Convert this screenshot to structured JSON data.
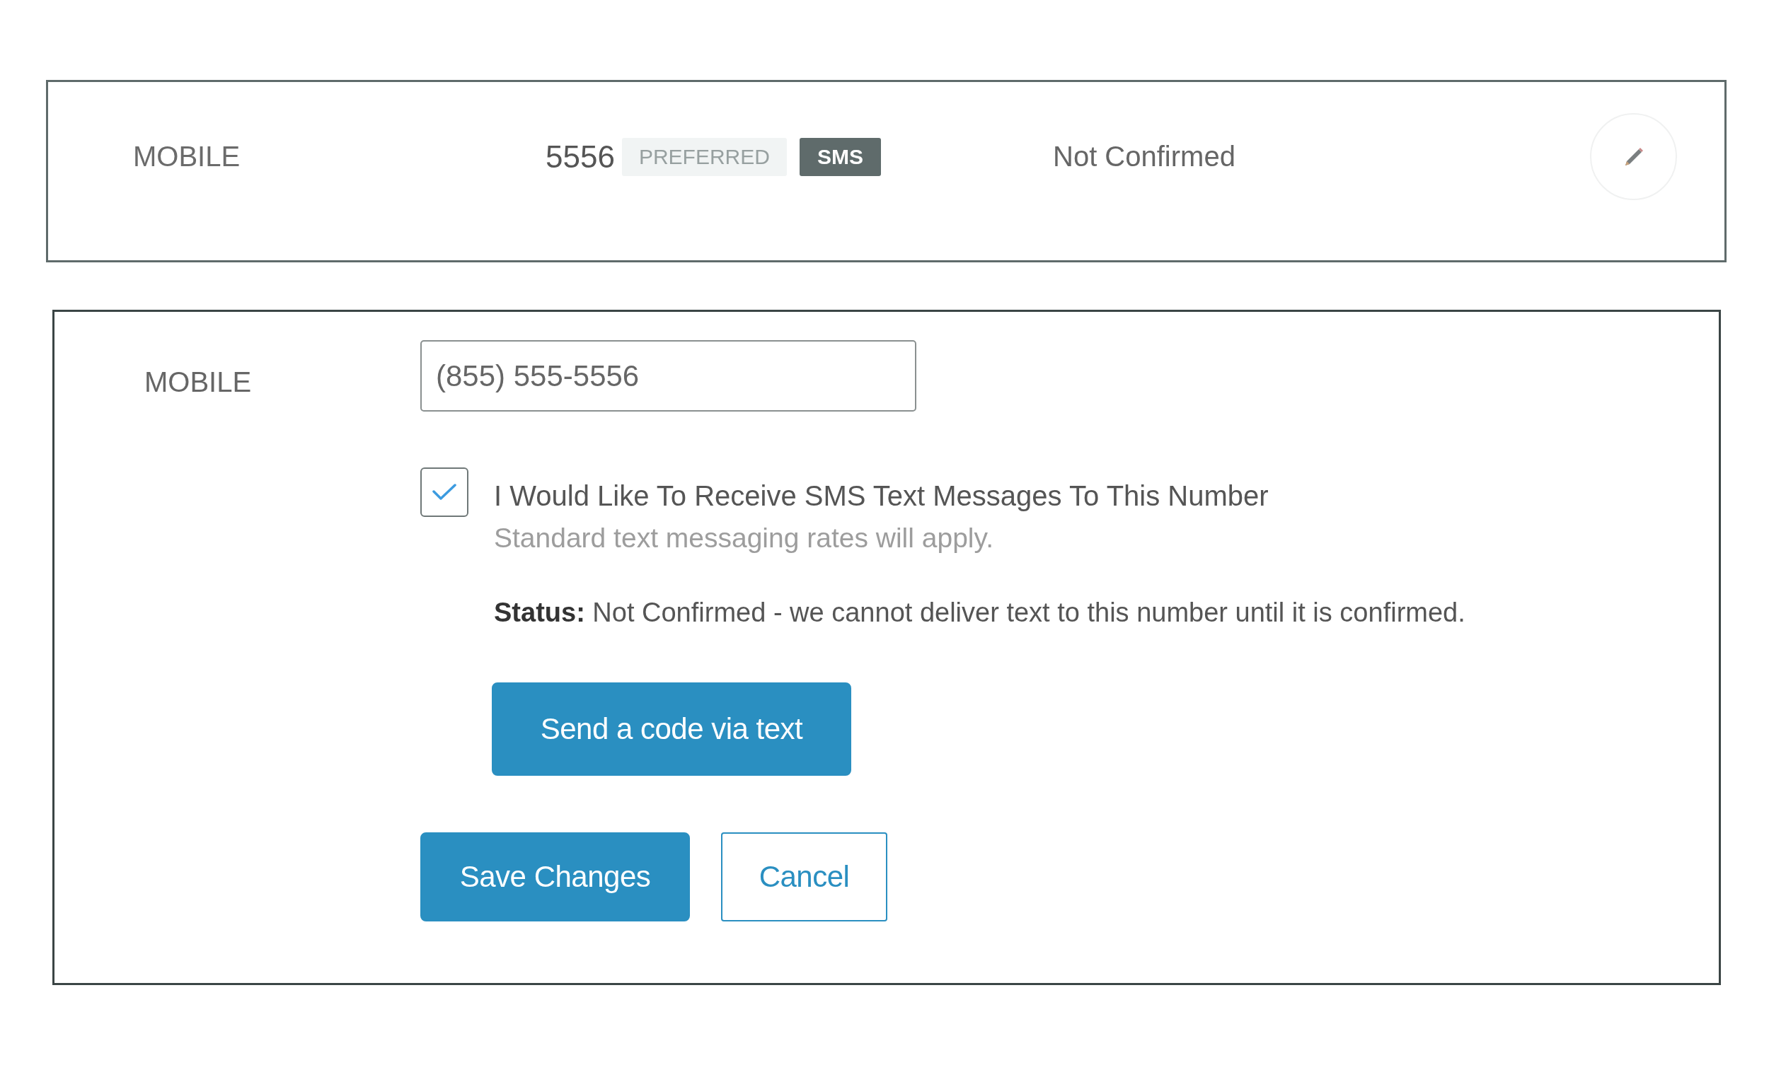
{
  "summary_card": {
    "type_label": "MOBILE",
    "number": "5556",
    "badges": [
      {
        "label": "PREFERRED",
        "kind": "light"
      },
      {
        "label": "SMS",
        "kind": "dark"
      }
    ],
    "status": "Not Confirmed"
  },
  "edit_form": {
    "type_label": "MOBILE",
    "phone_field": {
      "value": "(855) 555-5556"
    },
    "sms_opt_in": {
      "label": "I Would Like To Receive SMS Text Messages To This Number",
      "hint": "Standard text messaging rates will apply.",
      "checked": true
    },
    "status_note": "**Status:** Not Confirmed - we cannot deliver text to this number until it is confirmed.",
    "send_code_button": "Send a code via text",
    "buttons": [
      {
        "label": "Save Changes",
        "kind": "primary"
      },
      {
        "label": "Cancel",
        "kind": "secondary"
      }
    ]
  }
}
